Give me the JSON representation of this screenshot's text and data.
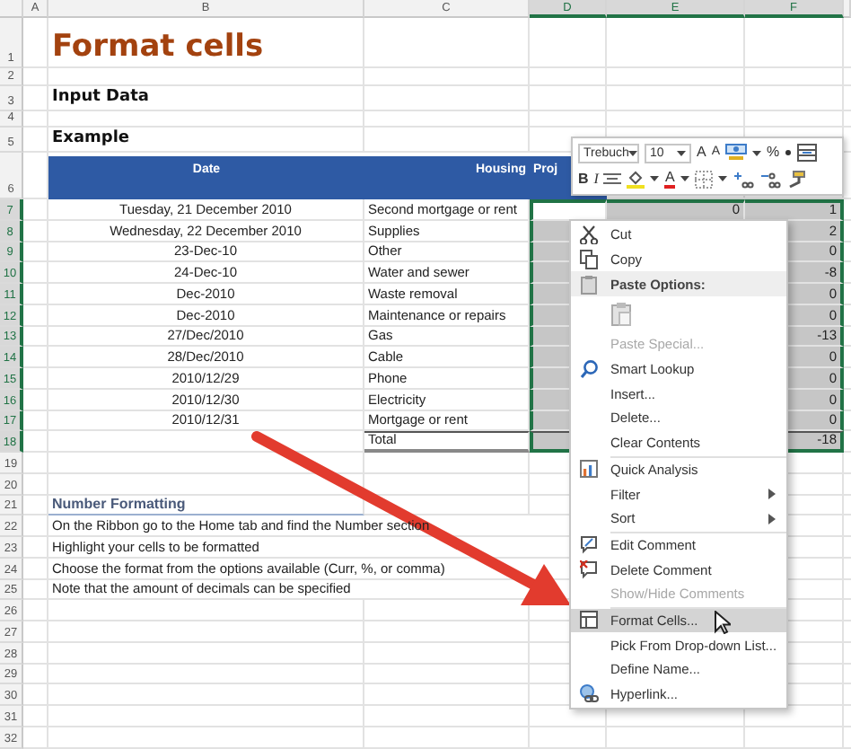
{
  "sheet": {
    "columns": [
      {
        "label": "A",
        "selected": false
      },
      {
        "label": "B",
        "selected": false
      },
      {
        "label": "C",
        "selected": false
      },
      {
        "label": "D",
        "selected": true
      },
      {
        "label": "E",
        "selected": true
      },
      {
        "label": "F",
        "selected": true
      }
    ],
    "row_numbers": [
      {
        "label": "1",
        "selected": false
      },
      {
        "label": "2",
        "selected": false
      },
      {
        "label": "3",
        "selected": false
      },
      {
        "label": "4",
        "selected": false
      },
      {
        "label": "5",
        "selected": false
      },
      {
        "label": "6",
        "selected": false
      },
      {
        "label": "7",
        "selected": true
      },
      {
        "label": "8",
        "selected": true
      },
      {
        "label": "9",
        "selected": true
      },
      {
        "label": "10",
        "selected": true
      },
      {
        "label": "11",
        "selected": true
      },
      {
        "label": "12",
        "selected": true
      },
      {
        "label": "13",
        "selected": true
      },
      {
        "label": "14",
        "selected": true
      },
      {
        "label": "15",
        "selected": true
      },
      {
        "label": "16",
        "selected": true
      },
      {
        "label": "17",
        "selected": true
      },
      {
        "label": "18",
        "selected": true
      },
      {
        "label": "19",
        "selected": false
      },
      {
        "label": "20",
        "selected": false
      },
      {
        "label": "21",
        "selected": false
      },
      {
        "label": "22",
        "selected": false
      },
      {
        "label": "23",
        "selected": false
      },
      {
        "label": "24",
        "selected": false
      },
      {
        "label": "25",
        "selected": false
      },
      {
        "label": "26",
        "selected": false
      },
      {
        "label": "27",
        "selected": false
      },
      {
        "label": "28",
        "selected": false
      },
      {
        "label": "29",
        "selected": false
      },
      {
        "label": "30",
        "selected": false
      },
      {
        "label": "31",
        "selected": false
      },
      {
        "label": "32",
        "selected": false
      }
    ],
    "title": "Format cells",
    "input_heading": "Input Data",
    "example_heading": "Example",
    "table": {
      "columns": [
        "Date",
        "Housing",
        "Proj"
      ],
      "rows": [
        {
          "kind": "data",
          "date": "Tuesday, 21 December 2010",
          "item": "Second mortgage or rent",
          "values": {
            "e": "0",
            "f": "1"
          }
        },
        {
          "kind": "data",
          "date": "Wednesday, 22 December 2010",
          "item": "Supplies",
          "values": {
            "f": "2"
          }
        },
        {
          "kind": "data",
          "date": "23-Dec-10",
          "item": "Other",
          "values": {
            "f": "0"
          }
        },
        {
          "kind": "data",
          "date": "24-Dec-10",
          "item": "Water and sewer",
          "values": {
            "f": "-8"
          }
        },
        {
          "kind": "data",
          "date": "Dec-2010",
          "item": "Waste removal",
          "values": {
            "f": "0"
          }
        },
        {
          "kind": "data",
          "date": "Dec-2010",
          "item": "Maintenance or repairs",
          "values": {
            "f": "0"
          }
        },
        {
          "kind": "data",
          "date": "27/Dec/2010",
          "item": "Gas",
          "values": {
            "f": "-13"
          }
        },
        {
          "kind": "data",
          "date": "28/Dec/2010",
          "item": "Cable",
          "values": {
            "f": "0"
          }
        },
        {
          "kind": "data",
          "date": "2010/12/29",
          "item": "Phone",
          "values": {
            "f": "0"
          }
        },
        {
          "kind": "data",
          "date": "2010/12/30",
          "item": "Electricity",
          "values": {
            "f": "0"
          }
        },
        {
          "kind": "data",
          "date": "2010/12/31",
          "item": "Mortgage or rent",
          "values": {
            "f": "0"
          }
        },
        {
          "kind": "total",
          "item": "Total",
          "values": {
            "f": "-18"
          }
        }
      ]
    },
    "notes": {
      "heading": "Number Formatting",
      "lines": [
        "On the Ribbon go to the Home tab and find the Number section",
        "Highlight your cells to be formatted",
        "Choose the format from the options available (Curr, %, or comma)",
        "Note that the amount of decimals can be specified"
      ]
    }
  },
  "mini_toolbar": {
    "font": "Trebuch",
    "size": "10",
    "row1": [
      {
        "kind": "grow",
        "label": "A"
      },
      {
        "kind": "shrink",
        "label": "A"
      },
      {
        "kind": "accounting"
      },
      {
        "kind": "caret"
      },
      {
        "kind": "text",
        "label": "%"
      },
      {
        "kind": "comma"
      },
      {
        "kind": "merge"
      }
    ],
    "row2": [
      {
        "kind": "bold",
        "label": "B"
      },
      {
        "kind": "italic",
        "label": "I"
      },
      {
        "kind": "align"
      },
      {
        "kind": "fill"
      },
      {
        "kind": "caret"
      },
      {
        "kind": "fontcolor",
        "label": "A"
      },
      {
        "kind": "caret"
      },
      {
        "kind": "borders"
      },
      {
        "kind": "caret"
      },
      {
        "kind": "incdec"
      },
      {
        "kind": "decdec"
      },
      {
        "kind": "painter"
      }
    ]
  },
  "context_menu": {
    "items": [
      {
        "kind": "command",
        "label": "Cut",
        "disabled": false,
        "submenu": false,
        "selected": false
      },
      {
        "kind": "command",
        "label": "Copy",
        "disabled": false,
        "submenu": false,
        "selected": false
      },
      {
        "kind": "header",
        "label": "Paste Options:"
      },
      {
        "kind": "paste-icons"
      },
      {
        "kind": "command",
        "label": "Paste Special...",
        "disabled": true,
        "submenu": false,
        "selected": false
      },
      {
        "kind": "command",
        "label": "Smart Lookup",
        "disabled": false,
        "submenu": false,
        "selected": false
      },
      {
        "kind": "command",
        "label": "Insert...",
        "disabled": false,
        "submenu": false,
        "selected": false
      },
      {
        "kind": "command",
        "label": "Delete...",
        "disabled": false,
        "submenu": false,
        "selected": false
      },
      {
        "kind": "command",
        "label": "Clear Contents",
        "disabled": false,
        "submenu": false,
        "selected": false
      },
      {
        "kind": "separator"
      },
      {
        "kind": "command",
        "label": "Quick Analysis",
        "disabled": false,
        "submenu": false,
        "selected": false
      },
      {
        "kind": "command",
        "label": "Filter",
        "disabled": false,
        "submenu": true,
        "selected": false
      },
      {
        "kind": "command",
        "label": "Sort",
        "disabled": false,
        "submenu": true,
        "selected": false
      },
      {
        "kind": "separator"
      },
      {
        "kind": "command",
        "label": "Edit Comment",
        "disabled": false,
        "submenu": false,
        "selected": false
      },
      {
        "kind": "command",
        "label": "Delete Comment",
        "disabled": false,
        "submenu": false,
        "selected": false
      },
      {
        "kind": "command",
        "label": "Show/Hide Comments",
        "disabled": true,
        "submenu": false,
        "selected": false
      },
      {
        "kind": "separator"
      },
      {
        "kind": "command",
        "label": "Format Cells...",
        "disabled": false,
        "submenu": false,
        "selected": true
      },
      {
        "kind": "command",
        "label": "Pick From Drop-down List...",
        "disabled": false,
        "submenu": false,
        "selected": false
      },
      {
        "kind": "command",
        "label": "Define Name...",
        "disabled": false,
        "submenu": false,
        "selected": false
      },
      {
        "kind": "command",
        "label": "Hyperlink...",
        "disabled": false,
        "submenu": false,
        "selected": false
      }
    ]
  }
}
